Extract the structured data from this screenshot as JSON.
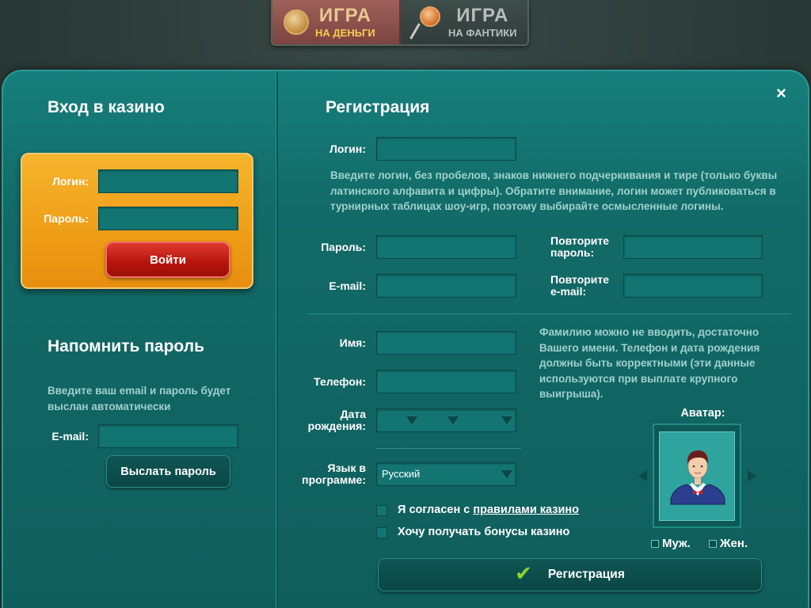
{
  "top_tabs": [
    {
      "big": "ИГРА",
      "small": "НА ДЕНЬГИ"
    },
    {
      "big": "ИГРА",
      "small": "НА ФАНТИКИ"
    }
  ],
  "close_icon": "×",
  "login": {
    "title": "Вход в казино",
    "login_label": "Логин:",
    "password_label": "Пароль:",
    "login_value": "",
    "password_value": "",
    "submit": "Войти"
  },
  "remind": {
    "title": "Напомнить пароль",
    "hint": "Введите ваш email и пароль будет выслан автоматически",
    "email_label": "E-mail:",
    "email_value": "",
    "submit": "Выслать пароль"
  },
  "register": {
    "title": "Регистрация",
    "login_label": "Логин:",
    "login_hint": "Введите логин, без пробелов, знаков нижнего подчеркивания и тире (только буквы латинского алфавита и цифры). Обратите внимание, логин может публиковаться в турнирных таблицах шоу-игр, поэтому выбирайте осмысленные логины.",
    "password_label": "Пароль:",
    "repeat_password_label_1": "Повторите",
    "repeat_password_label_2": "пароль:",
    "email_label": "E-mail:",
    "repeat_email_label_1": "Повторите",
    "repeat_email_label_2": "e-mail:",
    "name_label": "Имя:",
    "phone_label": "Телефон:",
    "birth_label_1": "Дата",
    "birth_label_2": "рождения:",
    "personal_hint": "Фамилию можно не вводить, достаточно Вашего имени. Телефон и дата рождения должны быть корректными (эти данные используются при выплате крупного выигрыша).",
    "language_label_1": "Язык в",
    "language_label_2": "программе:",
    "language_value": "Русский",
    "agree_text": "Я согласен с ",
    "agree_link": "правилами казино",
    "bonus_text": "Хочу получать бонусы казино",
    "avatar_label": "Аватар:",
    "gender_male": "Муж.",
    "gender_female": "Жен.",
    "submit": "Регистрация"
  },
  "colors": {
    "panel": "#137572",
    "login_box": "#ef9d16",
    "login_button": "#b8170f",
    "hint_text": "#9fd0cd"
  }
}
